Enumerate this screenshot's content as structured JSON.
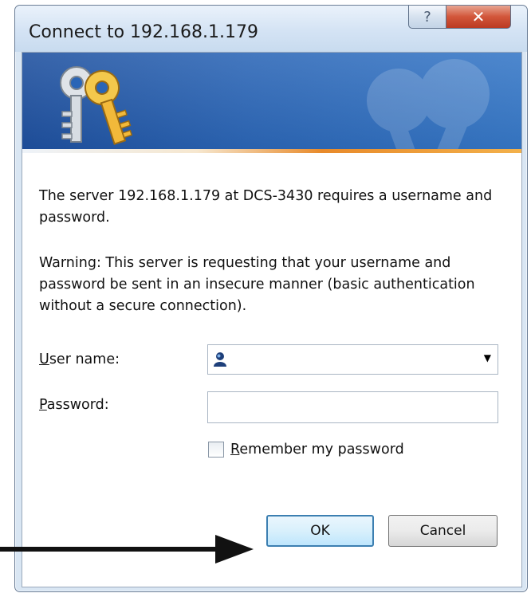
{
  "dialog": {
    "title": "Connect to 192.168.1.179",
    "help_glyph": "?",
    "close_glyph": "✕"
  },
  "messages": {
    "server_line": "The server 192.168.1.179 at DCS-3430 requires a username and password.",
    "warning_line": "Warning: This server is requesting that your username and password be sent in an insecure manner (basic authentication without a secure connection)."
  },
  "form": {
    "username_label_mnemonic": "U",
    "username_label_rest": "ser name:",
    "username_value": "",
    "password_label_mnemonic": "P",
    "password_label_rest": "assword:",
    "password_value": "",
    "remember_mnemonic": "R",
    "remember_rest": "emember my password",
    "remember_checked": false
  },
  "buttons": {
    "ok": "OK",
    "cancel": "Cancel"
  },
  "icons": {
    "banner": "keys-icon",
    "username_field": "user-icon",
    "dropdown": "chevron-down-icon",
    "annotation": "arrow-right-icon"
  },
  "colors": {
    "banner_blue": "#2a65b6",
    "banner_accent_orange": "#e88a2a",
    "close_red": "#d2563a",
    "ok_border": "#3c7fb1",
    "annotation_arrow": "#111111"
  }
}
